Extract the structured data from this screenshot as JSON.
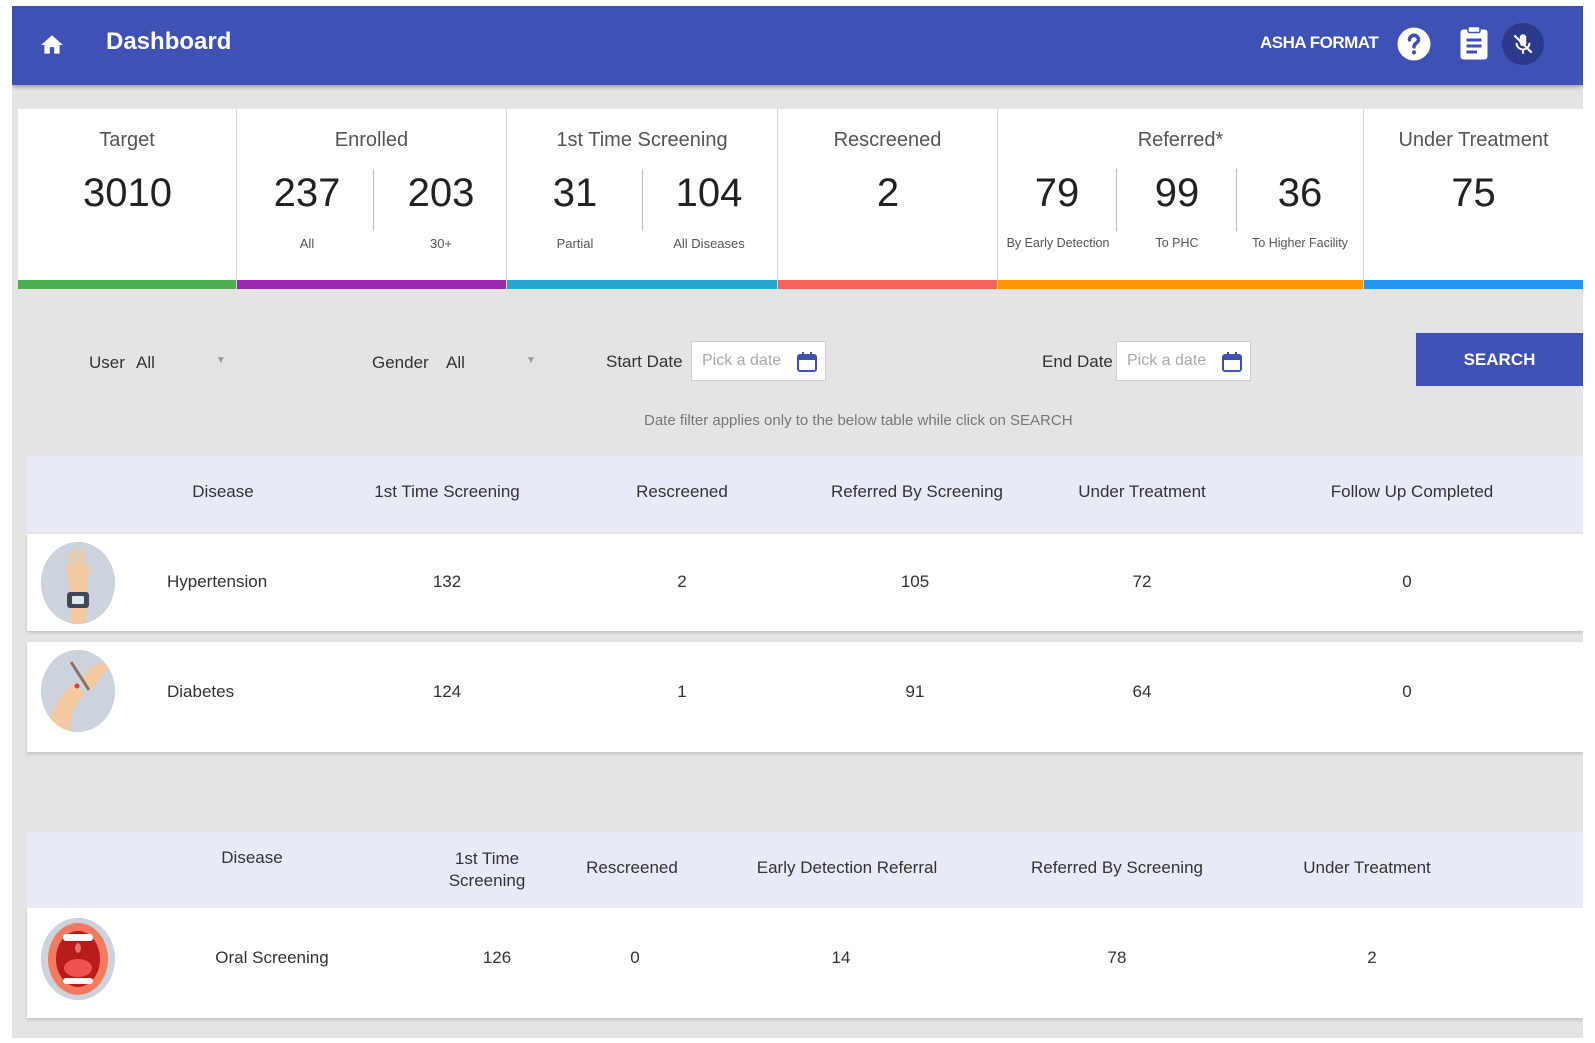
{
  "header": {
    "title": "Dashboard",
    "format_label": "ASHA FORMAT"
  },
  "stats": {
    "target": {
      "title": "Target",
      "value": "3010"
    },
    "enrolled": {
      "title": "Enrolled",
      "all_value": "237",
      "all_label": "All",
      "thirty_value": "203",
      "thirty_label": "30+"
    },
    "first_screening": {
      "title": "1st Time Screening",
      "partial_value": "31",
      "partial_label": "Partial",
      "all_value": "104",
      "all_label": "All Diseases"
    },
    "rescreened": {
      "title": "Rescreened",
      "value": "2"
    },
    "referred": {
      "title": "Referred*",
      "early_value": "79",
      "early_label": "By Early Detection",
      "phc_value": "99",
      "phc_label": "To PHC",
      "higher_value": "36",
      "higher_label": "To Higher Facility"
    },
    "under_treatment": {
      "title": "Under Treatment",
      "value": "75"
    }
  },
  "colors": {
    "target": "#4caf50",
    "enrolled": "#9c27b0",
    "first_screening": "#26a6d1",
    "rescreened": "#f4645a",
    "referred": "#ff9800",
    "under_treatment": "#2196f3",
    "primary": "#3f51b5"
  },
  "filters": {
    "user_label": "User",
    "user_value": "All",
    "gender_label": "Gender",
    "gender_value": "All",
    "start_label": "Start Date",
    "start_placeholder": "Pick a date",
    "end_label": "End Date",
    "end_placeholder": "Pick a date",
    "search_label": "SEARCH",
    "hint": "Date filter applies only to the below table while click on SEARCH"
  },
  "table1": {
    "headers": [
      "Disease",
      "1st Time Screening",
      "Rescreened",
      "Referred By Screening",
      "Under Treatment",
      "Follow Up Completed"
    ],
    "rows": [
      {
        "disease": "Hypertension",
        "first": "132",
        "rescreened": "2",
        "referred": "105",
        "treatment": "72",
        "followup": "0"
      },
      {
        "disease": "Diabetes",
        "first": "124",
        "rescreened": "1",
        "referred": "91",
        "treatment": "64",
        "followup": "0"
      }
    ]
  },
  "table2": {
    "headers": [
      "Disease",
      "1st Time Screening",
      "Rescreened",
      "Early Detection Referral",
      "Referred By Screening",
      "Under Treatment"
    ],
    "header_first_line1": "1st Time",
    "header_first_line2": "Screening",
    "rows": [
      {
        "disease": "Oral Screening",
        "first": "126",
        "rescreened": "0",
        "early": "14",
        "referred": "78",
        "treatment": "2"
      }
    ]
  },
  "icons": {
    "home": "home-icon",
    "help": "help-icon",
    "clipboard": "clipboard-icon",
    "mic": "mic-off-icon",
    "calendar": "calendar-icon"
  }
}
